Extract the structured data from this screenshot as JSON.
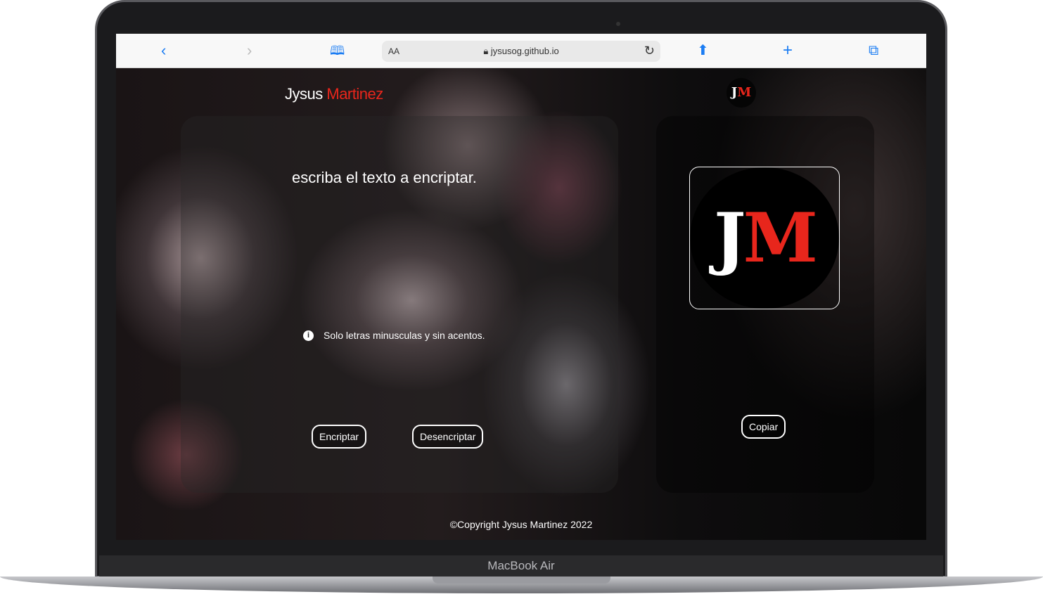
{
  "device": {
    "label": "MacBook Air"
  },
  "browser": {
    "url": "jysusog.github.io",
    "text_size_label": "AA",
    "icons": [
      "chevron-left-icon",
      "chevron-right-icon",
      "book-icon",
      "lock-icon",
      "reload-icon",
      "share-icon",
      "plus-icon",
      "tabs-icon"
    ],
    "accent": "#1a7cf3"
  },
  "header": {
    "brand_first": "Jysus",
    "brand_last": "Martinez",
    "avatar_j": "J",
    "avatar_m": "M",
    "brand_accent": "#e8261c"
  },
  "main": {
    "prompt": "escriba el texto a encriptar.",
    "hint": "Solo letras minusculas y sin acentos.",
    "hint_icon": "i",
    "encrypt_label": "Encriptar",
    "decrypt_label": "Desencriptar"
  },
  "output": {
    "logo_j": "J",
    "logo_m": "M",
    "copy_label": "Copiar"
  },
  "footer": {
    "text": "©Copyright Jysus Martinez 2022"
  }
}
